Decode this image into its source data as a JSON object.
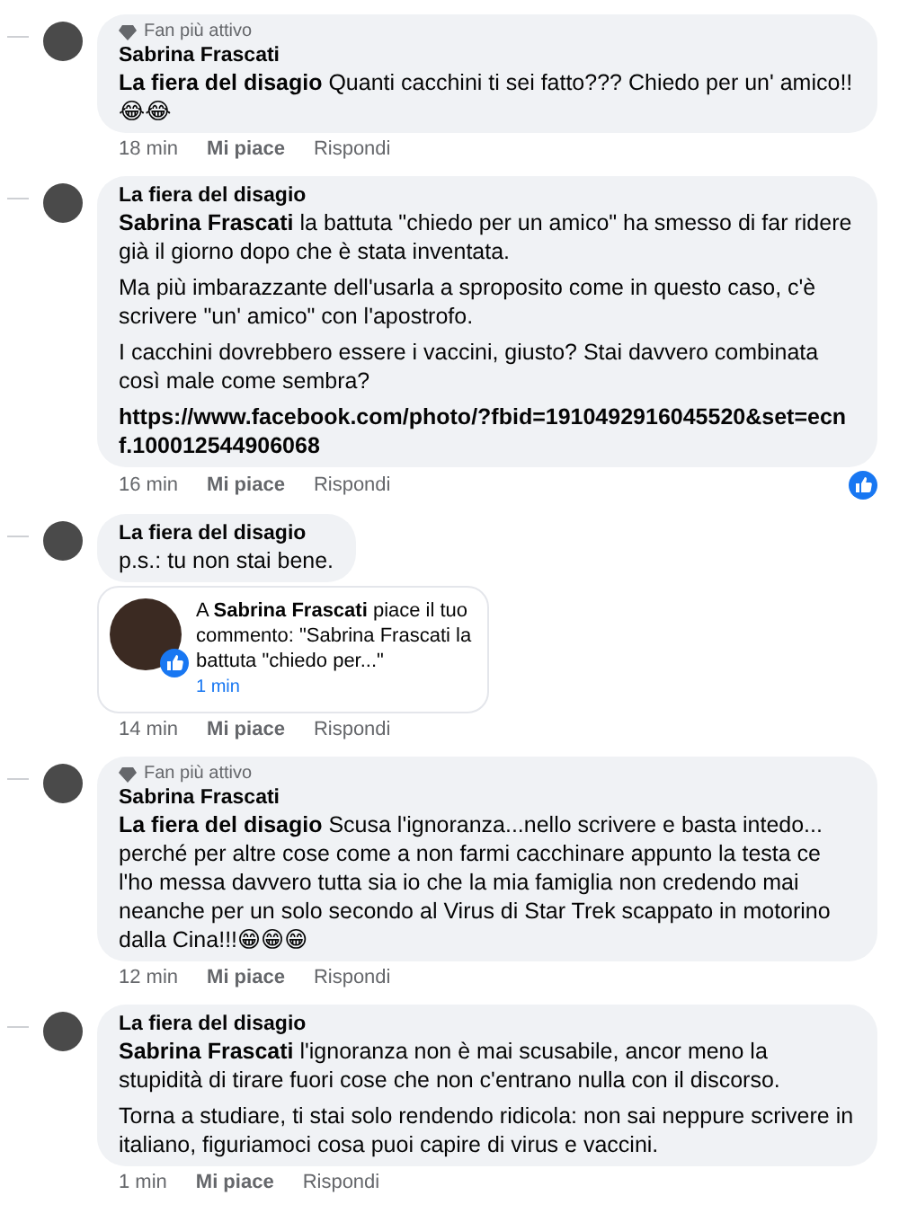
{
  "comments": [
    {
      "badge": "Fan più attivo",
      "author": "Sabrina Frascati",
      "paragraphs": [
        {
          "text": "**La fiera del disagio** Quanti cacchini ti sei fatto??? Chiedo per un' amico!!",
          "emoji": "😂😂"
        }
      ],
      "time": "18 min",
      "like": "Mi piace",
      "reply": "Rispondi",
      "liked": false
    },
    {
      "author": "La fiera del disagio",
      "paragraphs": [
        {
          "text": "**Sabrina Frascati** la battuta \"chiedo per un amico\" ha smesso di far ridere già il giorno dopo che è stata inventata."
        },
        {
          "text": "Ma più imbarazzante dell'usarla a sproposito come in questo caso, c'è scrivere \"un' amico\" con l'apostrofo."
        },
        {
          "text": "I cacchini dovrebbero essere i vaccini, giusto? Stai davvero combinata così male come sembra?"
        },
        {
          "kind": "link",
          "text": "https://www.facebook.com/photo/?fbid=1910492916045520&set=ecnf.100012544906068"
        }
      ],
      "time": "16 min",
      "like": "Mi piace",
      "reply": "Rispondi",
      "liked": true
    },
    {
      "author": "La fiera del disagio",
      "paragraphs": [
        {
          "text": "p.s.: tu non stai bene."
        }
      ],
      "notification": {
        "text": "A **Sabrina Frascati** piace il tuo commento: \"Sabrina Frascati la battuta \"chiedo per...\"",
        "time": "1 min"
      },
      "time": "14 min",
      "like": "Mi piace",
      "reply": "Rispondi",
      "liked": false
    },
    {
      "badge": "Fan più attivo",
      "author": "Sabrina Frascati",
      "paragraphs": [
        {
          "text": "**La fiera del disagio** Scusa l'ignoranza...nello scrivere e basta intedo... perché per altre cose come a non farmi cacchinare appunto la testa ce l'ho messa davvero tutta sia io che la mia famiglia non credendo mai neanche per un solo secondo al Virus di Star Trek scappato in motorino dalla Cina!!!",
          "emoji": "😁😁😁"
        }
      ],
      "time": "12 min",
      "like": "Mi piace",
      "reply": "Rispondi",
      "liked": false
    },
    {
      "author": "La fiera del disagio",
      "paragraphs": [
        {
          "text": "**Sabrina Frascati** l'ignoranza non è mai scusabile, ancor meno la stupidità di tirare fuori cose che non c'entrano nulla con il discorso."
        },
        {
          "text": "Torna a studiare, ti stai solo rendendo ridicola: non sai neppure scrivere in italiano, figuriamoci cosa puoi capire di virus e vaccini."
        }
      ],
      "time": "1 min",
      "like": "Mi piace",
      "reply": "Rispondi",
      "liked": false
    }
  ]
}
